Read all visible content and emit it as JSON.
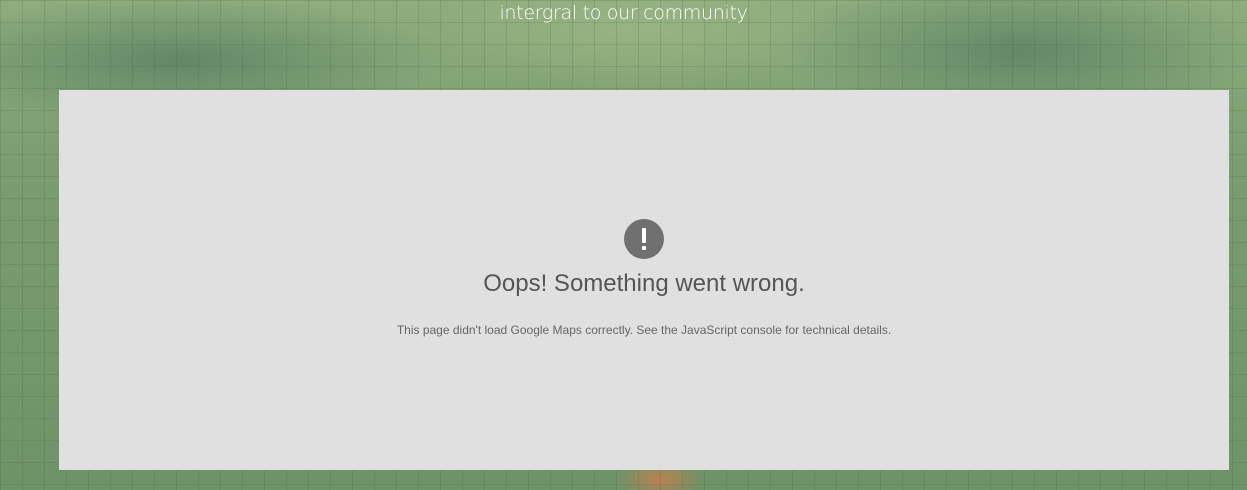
{
  "header": {
    "tagline": "intergral to our community"
  },
  "map_error": {
    "icon": "exclamation-icon",
    "title": "Oops! Something went wrong.",
    "description": "This page didn't load Google Maps correctly. See the JavaScript console for technical details."
  }
}
